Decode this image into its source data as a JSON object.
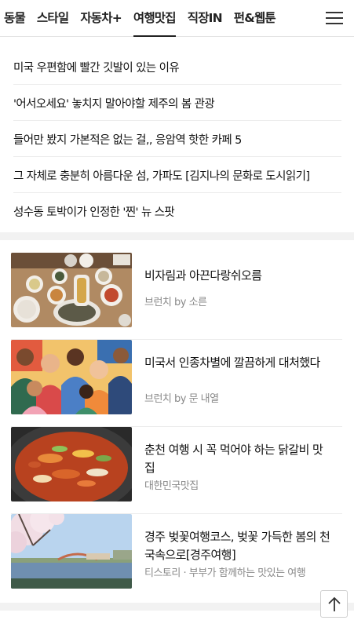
{
  "nav": {
    "tabs": [
      "동물",
      "스타일",
      "자동차+",
      "여행맛집",
      "직장IN",
      "펀&웹툰"
    ],
    "active_index": 3,
    "menu_icon": "hamburger-menu-icon"
  },
  "headlines": [
    "미국 우편함에 빨간 깃발이 있는 이유",
    "'어서오세요' 놓치지 말아야할 제주의 봄 관광",
    "들어만 봤지 가본적은 없는 걸,, 응암역 핫한 카페 5",
    "그 자체로 충분히 아름다운 섬, 가파도 [김지나의 문화로 도시읽기]",
    "성수동 토박이가 인정한 '찐' 뉴 스팟"
  ],
  "cards": [
    {
      "title": "비자림과 아끈다랑쉬오름",
      "source": "브런치 by 소른",
      "thumb": "korean-meal-table-photo"
    },
    {
      "title": "미국서 인종차별에 깔끔하게 대처했다",
      "source": "브런치 by 문 내열",
      "thumb": "crowd-of-people-illustration"
    },
    {
      "title": "춘천 여행 시 꼭 먹어야 하는 닭갈비 맛집",
      "source": "대한민국맛집",
      "thumb": "dakgalbi-pan-photo"
    },
    {
      "title": "경주 벚꽃여행코스, 벚꽃 가득한 봄의 천국속으로[경주여행]",
      "source": "티스토리 · 부부가 함께하는 맛있는 여행",
      "thumb": "cherry-blossom-lake-photo"
    }
  ],
  "scroll_top_icon": "arrow-up-icon"
}
